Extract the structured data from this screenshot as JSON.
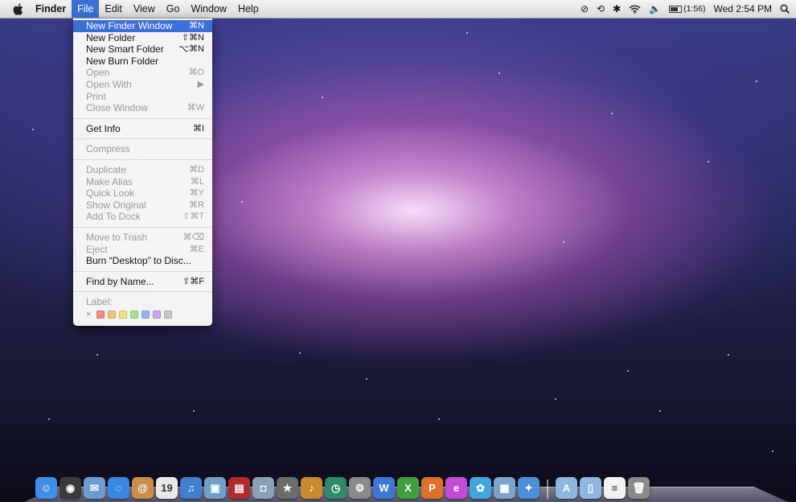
{
  "menubar": {
    "app_name": "Finder",
    "items": [
      "File",
      "Edit",
      "View",
      "Go",
      "Window",
      "Help"
    ],
    "active_item": "File",
    "status": {
      "battery_text": "(1:56)",
      "battery_level_percent": 70,
      "clock": "Wed 2:54 PM",
      "icons": [
        "clock-sync-icon",
        "time-machine-icon",
        "bluetooth-icon",
        "wifi-icon",
        "volume-icon",
        "battery-icon",
        "spotlight-search-icon"
      ]
    }
  },
  "file_menu": {
    "items": [
      {
        "label": "New Finder Window",
        "shortcut": "⌘N",
        "state": "selected"
      },
      {
        "label": "New Folder",
        "shortcut": "⇧⌘N",
        "state": "enabled"
      },
      {
        "label": "New Smart Folder",
        "shortcut": "⌥⌘N",
        "state": "enabled"
      },
      {
        "label": "New Burn Folder",
        "shortcut": "",
        "state": "enabled"
      },
      {
        "label": "Open",
        "shortcut": "⌘O",
        "state": "disabled"
      },
      {
        "label": "Open With",
        "shortcut": "▶",
        "state": "disabled"
      },
      {
        "label": "Print",
        "shortcut": "",
        "state": "disabled"
      },
      {
        "label": "Close Window",
        "shortcut": "⌘W",
        "state": "disabled"
      },
      {
        "label": "Get Info",
        "shortcut": "⌘I",
        "state": "enabled"
      },
      {
        "label": "Compress",
        "shortcut": "",
        "state": "disabled"
      },
      {
        "label": "Duplicate",
        "shortcut": "⌘D",
        "state": "disabled"
      },
      {
        "label": "Make Alias",
        "shortcut": "⌘L",
        "state": "disabled"
      },
      {
        "label": "Quick Look",
        "shortcut": "⌘Y",
        "state": "disabled"
      },
      {
        "label": "Show Original",
        "shortcut": "⌘R",
        "state": "disabled"
      },
      {
        "label": "Add To Dock",
        "shortcut": "⇧⌘T",
        "state": "disabled"
      },
      {
        "label": "Move to Trash",
        "shortcut": "⌘⌫",
        "state": "disabled"
      },
      {
        "label": "Eject",
        "shortcut": "⌘E",
        "state": "disabled"
      },
      {
        "label": "Burn “Desktop” to Disc...",
        "shortcut": "",
        "state": "enabled"
      },
      {
        "label": "Find by Name...",
        "shortcut": "⇧⌘F",
        "state": "enabled"
      }
    ],
    "label_heading": "Label:",
    "label_none": "×",
    "label_colors": [
      "#f28b82",
      "#f7c27a",
      "#f2e27a",
      "#a6e08f",
      "#8fb8f2",
      "#c8a6ee",
      "#c8c8c8"
    ]
  },
  "dock": {
    "apps": [
      {
        "name": "finder-icon",
        "glyph": "☺",
        "color": "#3f8fe6"
      },
      {
        "name": "dashboard-icon",
        "glyph": "◉",
        "color": "#3a3a3a"
      },
      {
        "name": "mail-icon",
        "glyph": "✉",
        "color": "#6e9ccf"
      },
      {
        "name": "ichat-icon",
        "glyph": "◌",
        "color": "#3a86e0"
      },
      {
        "name": "address-book-icon",
        "glyph": "@",
        "color": "#c88e4a"
      },
      {
        "name": "ical-icon",
        "glyph": "19",
        "color": "#e8e8e8"
      },
      {
        "name": "itunes-icon",
        "glyph": "♫",
        "color": "#3f7fd0"
      },
      {
        "name": "iphoto-icon",
        "glyph": "▣",
        "color": "#6fa0c8"
      },
      {
        "name": "photo-booth-icon",
        "glyph": "▤",
        "color": "#b22a2a"
      },
      {
        "name": "image-capture-icon",
        "glyph": "◘",
        "color": "#8aa0b8"
      },
      {
        "name": "imovie-icon",
        "glyph": "★",
        "color": "#6b6b6b"
      },
      {
        "name": "garageband-icon",
        "glyph": "♪",
        "color": "#c9892f"
      },
      {
        "name": "time-machine-icon",
        "glyph": "◷",
        "color": "#2f8a6a"
      },
      {
        "name": "system-preferences-icon",
        "glyph": "⚙",
        "color": "#8a8a8a"
      },
      {
        "name": "word-icon",
        "glyph": "W",
        "color": "#3a78d4"
      },
      {
        "name": "excel-icon",
        "glyph": "X",
        "color": "#3da03a"
      },
      {
        "name": "powerpoint-icon",
        "glyph": "P",
        "color": "#e0702a"
      },
      {
        "name": "entourage-icon",
        "glyph": "e",
        "color": "#c44ad8"
      },
      {
        "name": "messenger-icon",
        "glyph": "✿",
        "color": "#3fa6e0"
      },
      {
        "name": "project-gallery-icon",
        "glyph": "▦",
        "color": "#7aa6cc"
      },
      {
        "name": "safari-icon",
        "glyph": "✦",
        "color": "#4a90d8"
      }
    ],
    "stacks": [
      {
        "name": "applications-folder-icon",
        "glyph": "A",
        "color": "#8fb6de"
      },
      {
        "name": "documents-folder-icon",
        "glyph": "▯",
        "color": "#8fb6de"
      },
      {
        "name": "docx-file-icon",
        "glyph": "≡",
        "color": "#f2f2f2"
      },
      {
        "name": "trash-icon",
        "glyph": "🗑",
        "color": "#8a8a8a"
      }
    ]
  }
}
